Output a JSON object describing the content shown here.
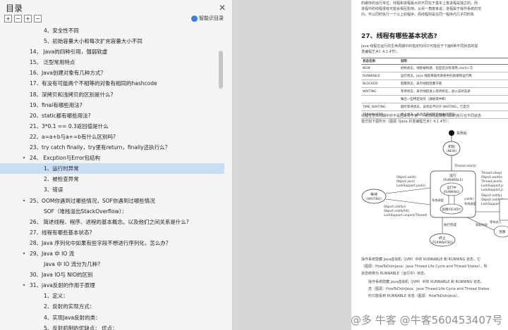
{
  "sidebar": {
    "title": "目录",
    "close_icon": "close-icon",
    "tools": [
      {
        "name": "expand-all-icon",
        "glyph": "+"
      },
      {
        "name": "collapse-all-icon",
        "glyph": "−"
      },
      {
        "name": "expand-level-icon",
        "glyph": "+"
      },
      {
        "name": "collapse-level-icon",
        "glyph": "−"
      }
    ],
    "smart_toc_label": "智能识目录",
    "active_color": "#c9def2",
    "items": [
      {
        "text": "4、安全性不同",
        "indent": 62
      },
      {
        "text": "5、初始容量大小和每次扩充容量大小不同",
        "indent": 62
      },
      {
        "text": "14、 Java的四种引用，强弱软虚",
        "indent": 42
      },
      {
        "text": "15、 泛型常用特点",
        "indent": 42
      },
      {
        "text": "16、Java创建对象有几种方式？",
        "indent": 42
      },
      {
        "text": "17、有没有可能两个不相等的对象有相同的hashcode",
        "indent": 42
      },
      {
        "text": "18、深拷贝和浅拷贝的区别是什么?",
        "indent": 42
      },
      {
        "text": "19、final有哪些用法?",
        "indent": 42
      },
      {
        "text": "20、static都有哪些用法?",
        "indent": 42
      },
      {
        "text": "21、3*0.1 == 0.3返回值是什么",
        "indent": 42
      },
      {
        "text": "22、a=a+b与a+=b有什么区别吗?",
        "indent": 42
      },
      {
        "text": "23、try catch finally，try里有return，finally还执行么？",
        "indent": 42
      },
      {
        "text": "24、 Excption与Error包结构",
        "indent": 42,
        "chevron": "down"
      },
      {
        "text": "1、运行时异常",
        "indent": 62,
        "active": true
      },
      {
        "text": "2、被检查异常",
        "indent": 62
      },
      {
        "text": "3、错误",
        "indent": 62
      },
      {
        "text": "25、OOM你遇到过哪些情况，SOF你遇到过哪些情况",
        "indent": 42,
        "chevron": "down"
      },
      {
        "text": "SOF（堆栈溢出StackOverflow）：",
        "indent": 62
      },
      {
        "text": "26、 简述线程、程序、进程的基本概念。以及他们之间关系是什么?",
        "indent": 42
      },
      {
        "text": "27、线程有哪些基本状态?",
        "indent": 42
      },
      {
        "text": "28、Java 序列化中如果有些字段不想进行序列化，怎么办？",
        "indent": 42
      },
      {
        "text": "29、Java 中 IO 流",
        "indent": 42,
        "chevron": "down"
      },
      {
        "text": "Java 中 IO 流分为几种?",
        "indent": 62
      },
      {
        "text": "30、Java IO与 NIO的区别",
        "indent": 42
      },
      {
        "text": "31、java反射的作用于原理",
        "indent": 42,
        "chevron": "down"
      },
      {
        "text": "1、定义：",
        "indent": 62
      },
      {
        "text": "2、反射的实现方式：",
        "indent": 62
      },
      {
        "text": "4、实现Java反射的类：",
        "indent": 62
      },
      {
        "text": "5、反射机制的优缺点：  优点：",
        "indent": 62
      },
      {
        "text": "32、说说List,Set,Map三者的区别？",
        "indent": 42
      }
    ]
  },
  "doc": {
    "top_lines": [
      "的缓存的运行单位，线程和进程最大的不同在于基本上各进程是独立的，而",
      "进程中的线程很有可能会相互影响。从另一角度来说，进程属于操作系统的范",
      "内，可以同时执行一个以上的程序，而线程则是在同一程序内几乎同时执"
    ],
    "heading": "27、线程有哪些基本状态?",
    "intro_lines": [
      "Java 线程在运行的生命周期中的指定时间只可能处于下面6种不同状态的其",
      "发编程艺术》4.1.4节）。"
    ],
    "table_headers": [
      "状态名称",
      "说明"
    ],
    "table_rows": [
      [
        "NEW",
        "初始状态，线程被构建，但是还没有调用 start() 方"
      ],
      [
        "RUNNABLE",
        "运行状态，Java 线程将操作系统中的就绪和运行两"
      ],
      [
        "BLOCKED",
        "阻塞状态，表示线程阻塞于锁"
      ],
      [
        "WAITING",
        "等待状态，表示线程进入等待状态，进入该状态表"
      ],
      [
        "",
        "做出一些特定动作（通知或中断）"
      ],
      [
        "TIME_WAITING",
        "超时等待状态，该状态不同于 WAITING，它是可"
      ],
      [
        "TERMINATED",
        "终止状态，表示当前线程已经执行完毕"
      ]
    ],
    "after_lines": [
      "线程在生命周期中并不是固定处于某一个状态而是随着代码的执行在不同状态",
      "变迁如下图所示（图源《Java 并发编程艺术》4.1.4节）："
    ],
    "diagram": {
      "instantiate": "实例化",
      "new_label": "初始",
      "new_sub": "(NEW)",
      "runnable_label": "运行",
      "runnable_sub": "(RUNNABLE)",
      "running_label": "运行中",
      "running_sub": "(RUNNING)",
      "ready_label": "就绪(READY)",
      "sched_label": "系统调度",
      "yield_label": "yield()",
      "sched2_label": "系统调度",
      "thread_start": "Thread.start()",
      "waiting_label": "等待",
      "waiting_sub": "(WAITING)",
      "wait_calls": [
        "Object.wait()",
        "Object.join()",
        "LockSupport.park()"
      ],
      "notify_calls": [
        "Object.notify()",
        "Object.notifyAll()",
        "LockSupport.unpark(Thread)"
      ],
      "right_calls": [
        "Thread.sleep(",
        "Object.wait(lo",
        "Thread.join(lo",
        "LockSupport.p",
        "LockSupport.p"
      ],
      "right_notify": [
        "Object.notify(",
        "Object.notifyAl",
        "LockSupport.unp"
      ],
      "done_label": "执行完成",
      "lock_label": "获取到锁",
      "wait_lock_label": "等待进入",
      "blocked_label": "阻塞",
      "terminated_label": "终止",
      "terminated_sub": "(TERMINATED)"
    },
    "bottom_lines": [
      "操作系统隐藏 Java虚拟机（JVM）中的 RUNNABLE 和 RUNNING 状态，它",
      "（图源：HowToDoInJava：Java Thread Life Cycle and Thread States），所",
      "状态统称为 RUNNABLE（运行中）状态。"
    ],
    "quote_lines": [
      "操作系统隐藏 Java虚拟机（JVM）中的 RUNNABLE 和 RUNNING 状态，",
      "态（图源：HowToDoInJava：Java Thread Life Cycle and Thread States",
      "时只能看到 RUNNABLE 状态（图源：HowToDoInJava）。"
    ]
  },
  "watermark": "@多 牛客 @牛客560453407号"
}
